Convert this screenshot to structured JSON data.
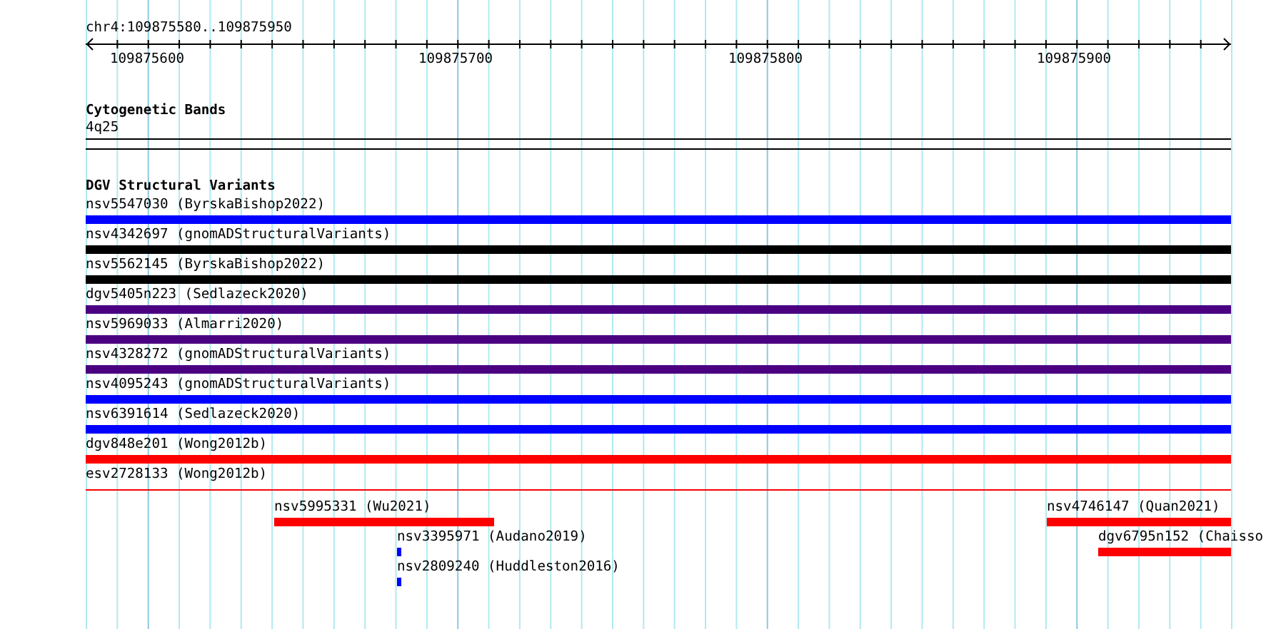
{
  "region": "chr4:109875580..109875950",
  "ruler": {
    "tick_labels": [
      "109875600",
      "109875700",
      "109875800",
      "109875900"
    ]
  },
  "cytogenetic_bands": {
    "title": "Cytogenetic Bands",
    "band": "4q25"
  },
  "dgv": {
    "title": "DGV Structural Variants",
    "features": [
      {
        "label": "nsv5547030 (ByrskaBishop2022)",
        "color": "#0000ff",
        "kind": "bar"
      },
      {
        "label": "nsv4342697 (gnomADStructuralVariants)",
        "color": "#000000",
        "kind": "bar"
      },
      {
        "label": "nsv5562145 (ByrskaBishop2022)",
        "color": "#000000",
        "kind": "bar"
      },
      {
        "label": "dgv5405n223 (Sedlazeck2020)",
        "color": "#4b0082",
        "kind": "bar"
      },
      {
        "label": "nsv5969033 (Almarri2020)",
        "color": "#4b0082",
        "kind": "bar"
      },
      {
        "label": "nsv4328272 (gnomADStructuralVariants)",
        "color": "#4b0082",
        "kind": "bar"
      },
      {
        "label": "nsv4095243 (gnomADStructuralVariants)",
        "color": "#0000ff",
        "kind": "bar"
      },
      {
        "label": "nsv6391614 (Sedlazeck2020)",
        "color": "#0000ff",
        "kind": "bar"
      },
      {
        "label": "dgv848e201 (Wong2012b)",
        "color": "#ff0000",
        "kind": "bar"
      },
      {
        "label": "esv2728133 (Wong2012b)",
        "color": "#ff0000",
        "kind": "thin"
      }
    ],
    "partial_features": [
      {
        "label": "nsv5995331 (Wu2021)",
        "color": "#ff0000"
      },
      {
        "label": "nsv4746147 (Quan2021)",
        "color": "#ff0000"
      },
      {
        "label": "nsv3395971 (Audano2019)",
        "color": "#0000ff"
      },
      {
        "label": "dgv6795n152 (Chaisso",
        "color": "#ff0000"
      },
      {
        "label": "nsv2809240 (Huddleston2016)",
        "color": "#0000ff"
      }
    ]
  }
}
